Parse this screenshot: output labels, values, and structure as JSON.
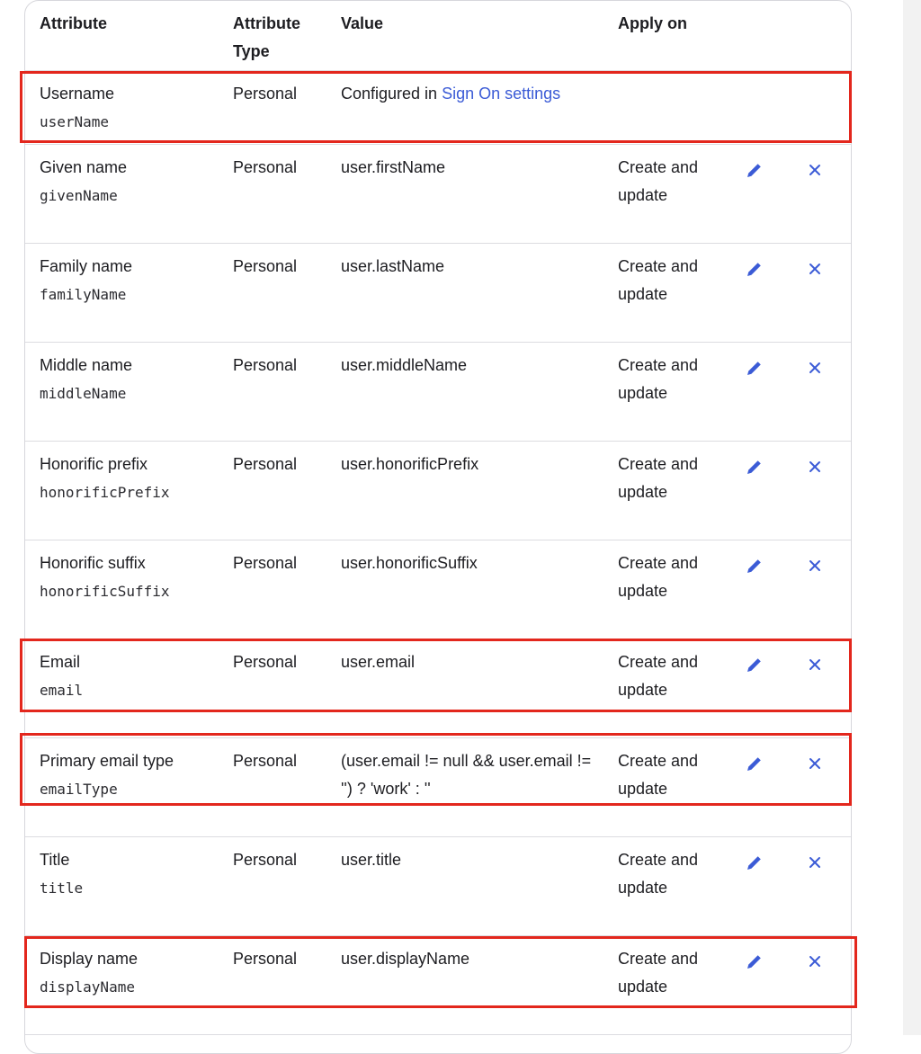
{
  "header": {
    "attribute": "Attribute",
    "attribute_type": "Attribute Type",
    "value": "Value",
    "apply_on": "Apply on"
  },
  "rows": [
    {
      "label": "Username",
      "key": "userName",
      "type": "Personal",
      "value_prefix": "Configured in ",
      "value_link": "Sign On settings",
      "apply": ""
    },
    {
      "label": "Given name",
      "key": "givenName",
      "type": "Personal",
      "value": "user.firstName",
      "apply": "Create and update"
    },
    {
      "label": "Family name",
      "key": "familyName",
      "type": "Personal",
      "value": "user.lastName",
      "apply": "Create and update"
    },
    {
      "label": "Middle name",
      "key": "middleName",
      "type": "Personal",
      "value": "user.middleName",
      "apply": "Create and update"
    },
    {
      "label": "Honorific prefix",
      "key": "honorificPrefix",
      "type": "Personal",
      "value": "user.honorificPrefix",
      "apply": "Create and update"
    },
    {
      "label": "Honorific suffix",
      "key": "honorificSuffix",
      "type": "Personal",
      "value": "user.honorificSuffix",
      "apply": "Create and update"
    },
    {
      "label": "Email",
      "key": "email",
      "type": "Personal",
      "value": "user.email",
      "apply": "Create and update"
    },
    {
      "label": "Primary email type",
      "key": "emailType",
      "type": "Personal",
      "value": "(user.email != null && user.email != '') ? 'work' : ''",
      "apply": "Create and update"
    },
    {
      "label": "Title",
      "key": "title",
      "type": "Personal",
      "value": "user.title",
      "apply": "Create and update"
    },
    {
      "label": "Display name",
      "key": "displayName",
      "type": "Personal",
      "value": "user.displayName",
      "apply": "Create and update"
    }
  ],
  "icons": {
    "edit": "pencil-icon",
    "delete": "close-icon"
  },
  "colors": {
    "link": "#3b5bd6",
    "icon": "#3b5bd6",
    "highlight": "#e3271d",
    "border": "#d7d7dc"
  }
}
